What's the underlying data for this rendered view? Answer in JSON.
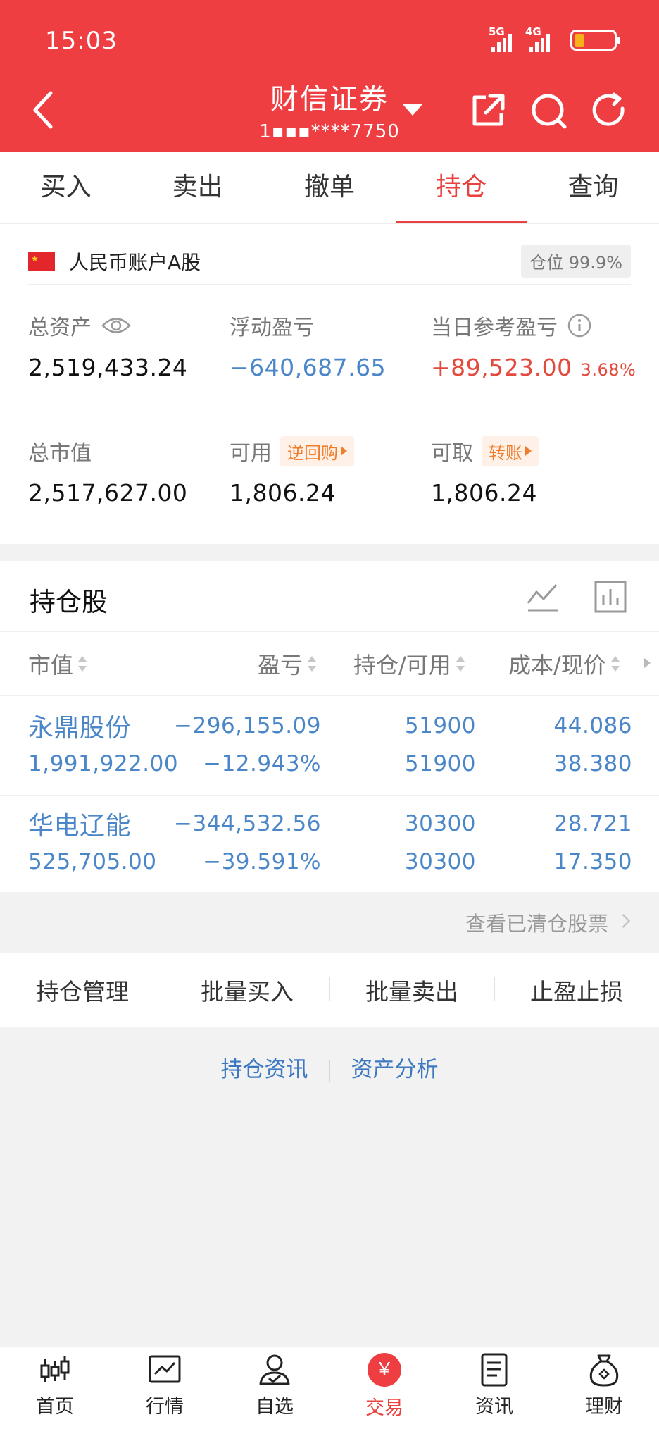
{
  "status_bar": {
    "time": "15:03",
    "net1": "5G",
    "net2": "4G"
  },
  "header": {
    "title": "财信证券",
    "account_masked": "1▪▪▪****7750"
  },
  "tabs": [
    {
      "label": "买入"
    },
    {
      "label": "卖出"
    },
    {
      "label": "撤单"
    },
    {
      "label": "持仓",
      "active": true
    },
    {
      "label": "查询"
    }
  ],
  "account": {
    "name": "人民币账户A股",
    "position": "仓位 99.9%",
    "total_assets_label": "总资产",
    "total_assets": "2,519,433.24",
    "floating_pl_label": "浮动盈亏",
    "floating_pl": "−640,687.65",
    "day_pl_label": "当日参考盈亏",
    "day_pl": "+89,523.00",
    "day_pl_pct": "3.68%",
    "market_value_label": "总市值",
    "market_value": "2,517,627.00",
    "available_label": "可用",
    "available_tag": "逆回购",
    "available": "1,806.24",
    "withdrawable_label": "可取",
    "withdrawable_tag": "转账",
    "withdrawable": "1,806.24"
  },
  "holdings": {
    "title": "持仓股",
    "columns": [
      "市值",
      "盈亏",
      "持仓/可用",
      "成本/现价"
    ],
    "rows": [
      {
        "name": "永鼎股份",
        "market_value": "1,991,922.00",
        "pl": "−296,155.09",
        "pl_pct": "−12.943%",
        "position": "51900",
        "available": "51900",
        "cost": "44.086",
        "price": "38.380"
      },
      {
        "name": "华电辽能",
        "market_value": "525,705.00",
        "pl": "−344,532.56",
        "pl_pct": "−39.591%",
        "position": "30300",
        "available": "30300",
        "cost": "28.721",
        "price": "17.350"
      }
    ],
    "cleared_link": "查看已清仓股票"
  },
  "actions": [
    "持仓管理",
    "批量买入",
    "批量卖出",
    "止盈止损"
  ],
  "links": [
    "持仓资讯",
    "资产分析"
  ],
  "bottom_nav": [
    {
      "label": "首页",
      "icon": "candlestick-icon"
    },
    {
      "label": "行情",
      "icon": "chart-line-icon"
    },
    {
      "label": "自选",
      "icon": "user-check-icon"
    },
    {
      "label": "交易",
      "icon": "yuan-icon",
      "glyph": "￥",
      "active": true
    },
    {
      "label": "资讯",
      "icon": "document-icon"
    },
    {
      "label": "理财",
      "icon": "money-bag-icon"
    }
  ],
  "colors": {
    "brand_red": "#ef3e42",
    "link_blue": "#4a86c8",
    "gain_red": "#e34a3e",
    "tag_orange": "#f07d2a"
  }
}
